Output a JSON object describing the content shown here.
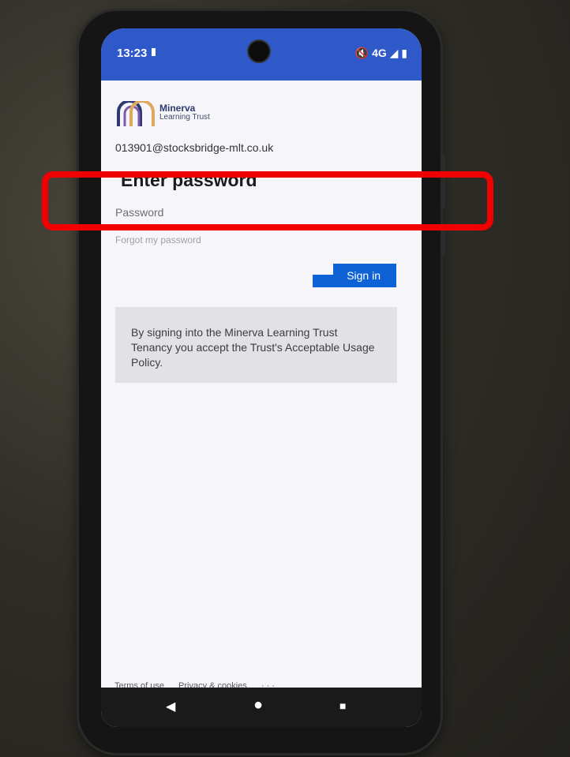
{
  "status_bar": {
    "time": "13:23",
    "indicators": "🔇 4G ◢ ▮"
  },
  "login": {
    "org_title": "Minerva",
    "org_subtitle": "Learning Trust",
    "email": "013901@stocksbridge-mlt.co.uk",
    "heading": "Enter password",
    "password_placeholder": "Password",
    "forgot_link": "Forgot my password",
    "signin_label": "Sign in",
    "notice": "By signing into the Minerva Learning Trust Tenancy you accept the Trust's Acceptable Usage Policy."
  },
  "footer": {
    "terms": "Terms of use",
    "privacy": "Privacy & cookies",
    "more": "· · ·"
  },
  "navigation": {
    "back_icon": "◀",
    "home_icon": "●",
    "recents_icon": "■"
  },
  "colors": {
    "status_bar": "#2f58c8",
    "signin_button": "#0f62d6",
    "highlight": "#f00000",
    "logo_arches": [
      "#2e3a6e",
      "#7b5aa8",
      "#e0a85c"
    ]
  }
}
